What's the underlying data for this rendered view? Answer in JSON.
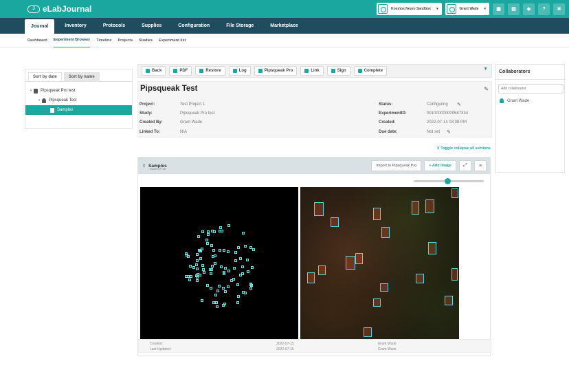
{
  "brand": {
    "name": "eLabJournal",
    "mark": "J"
  },
  "topbar": {
    "group_select": "Kosmos Neuro Sandbox",
    "user_select": "Grant Wade",
    "icons": [
      "grid-icon",
      "book-icon",
      "bell-icon",
      "help-icon",
      "gear-icon"
    ],
    "help_glyph": "?"
  },
  "mainnav": [
    "Journal",
    "Inventory",
    "Protocols",
    "Supplies",
    "Configuration",
    "File Storage",
    "Marketplace"
  ],
  "subnav": [
    "Dashboard",
    "Experiment Browser",
    "Timeline",
    "Projects",
    "Studies",
    "Experiment list"
  ],
  "tree": {
    "tabs": [
      "Sort by date",
      "Sort by name"
    ],
    "nodes": [
      {
        "label": "Pipsqueak Pro test",
        "twisty": "▾",
        "level": 0
      },
      {
        "label": "Pipsqueak Test",
        "twisty": "▾",
        "level": 1
      },
      {
        "label": "Samples",
        "twisty": "",
        "level": 2,
        "selected": true
      }
    ]
  },
  "toolbar": {
    "buttons": [
      "Back",
      "PDF",
      "Restore",
      "Log",
      "Pipsqueak Pro",
      "Link",
      "Sign",
      "Complete"
    ]
  },
  "experiment": {
    "title": "Pipsqueak Test",
    "left": [
      {
        "k": "Project:",
        "v": "Test Project 1"
      },
      {
        "k": "Study:",
        "v": "Pipsqueak Pro test"
      },
      {
        "k": "Created By:",
        "v": "Grant Wade"
      },
      {
        "k": "Linked To:",
        "v": "N/A"
      }
    ],
    "right": [
      {
        "k": "Status:",
        "v": "Configuring"
      },
      {
        "k": "ExperimentID:",
        "v": "001000000000587334"
      },
      {
        "k": "Created:",
        "v": "2022-07-14 03:08 PM"
      },
      {
        "k": "Due date:",
        "v": "Not set"
      }
    ],
    "toggle_link": "Toggle collapse all sections"
  },
  "section": {
    "title": "Samples",
    "date": "2022-07-15",
    "import_button": "Import to Pipsqueak Pro",
    "add_image_button": "+ Add Image",
    "footer": {
      "created_label": "Created:",
      "created_date": "2022-07-15",
      "created_by": "Grant Wade",
      "updated_label": "Last Updated:",
      "updated_date": "2022-07-15",
      "updated_by": "Grant Wade"
    }
  },
  "collaborators": {
    "title": "Collaborators",
    "placeholder": "Add collaborator",
    "users": [
      "Grant Wade"
    ]
  },
  "colors": {
    "brand": "#1aa7a0",
    "nav": "#1f4c5e"
  }
}
